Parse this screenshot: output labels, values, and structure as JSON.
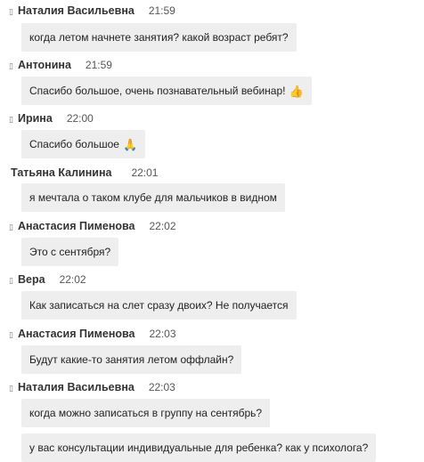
{
  "messages": [
    {
      "prefix": "𝌆",
      "author": "Наталия Васильевна",
      "time": "21:59",
      "texts": [
        "когда летом начнете занятия? какой возраст ребят?"
      ]
    },
    {
      "prefix": "𝌆",
      "author": "Антонина",
      "time": "21:59",
      "texts": [
        "Спасибо большое, очень познавательный вебинар!"
      ],
      "emoji": "👍"
    },
    {
      "prefix": "𝌆",
      "author": "Ирина",
      "time": "22:00",
      "texts": [
        "Спасибо большое"
      ],
      "emoji": "🙏"
    },
    {
      "prefix": "",
      "author": "Татьяна Калинина",
      "time": "22:01",
      "texts": [
        "я мечтала о таком клубе для мальчиков в видном"
      ]
    },
    {
      "prefix": "𝌆",
      "author": "Анастасия Пименова",
      "time": "22:02",
      "texts": [
        "Это с сентября?"
      ]
    },
    {
      "prefix": "𝌆",
      "author": "Вера",
      "time": "22:02",
      "texts": [
        "Как записаться на слет сразу двоих? Не получается"
      ]
    },
    {
      "prefix": "𝌆",
      "author": "Анастасия Пименова",
      "time": "22:03",
      "texts": [
        "Будут какие-то занятия летом оффлайн?"
      ]
    },
    {
      "prefix": "𝌆",
      "author": "Наталия Васильевна",
      "time": "22:03",
      "texts": [
        "когда можно записаться в группу на сентябрь?",
        "у вас консультации индивидуальные для ребенка? как у психолога?"
      ]
    }
  ]
}
